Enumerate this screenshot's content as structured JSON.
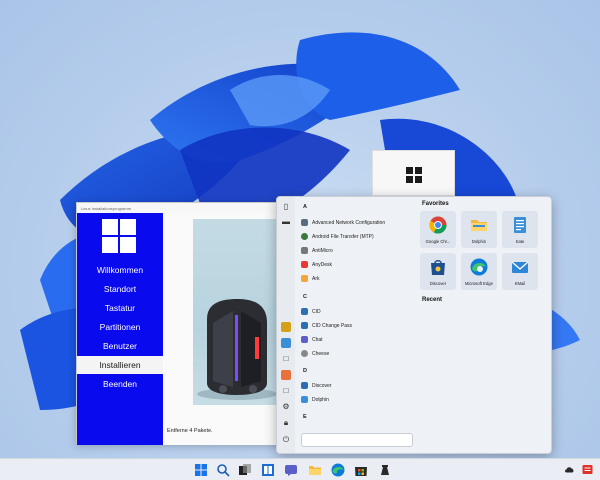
{
  "installer": {
    "title": "Linux Installationsprogramm",
    "sidebar": [
      {
        "label": "Willkommen",
        "active": false
      },
      {
        "label": "Standort",
        "active": false
      },
      {
        "label": "Tastatur",
        "active": false
      },
      {
        "label": "Partitionen",
        "active": false
      },
      {
        "label": "Benutzer",
        "active": false
      },
      {
        "label": "Installieren",
        "active": true
      },
      {
        "label": "Beenden",
        "active": false
      }
    ],
    "status": "Entferne 4 Pakete."
  },
  "start_menu": {
    "groups": [
      {
        "letter": "A",
        "apps": [
          {
            "label": "Advanced Network Configuration",
            "icon": "network-icon",
            "color": "#5a6b7d"
          },
          {
            "label": "Android File Transfer (MTP)",
            "icon": "android-icon",
            "color": "#3b7a3b"
          },
          {
            "label": "AntiMicro",
            "icon": "gamepad-icon",
            "color": "#777777"
          },
          {
            "label": "AnyDesk",
            "icon": "anydesk-icon",
            "color": "#e53935"
          },
          {
            "label": "Ark",
            "icon": "archive-icon",
            "color": "#f0a63a"
          }
        ]
      },
      {
        "letter": "C",
        "apps": [
          {
            "label": "CID",
            "icon": "cid-icon",
            "color": "#2c6fb3"
          },
          {
            "label": "CID Change Pass",
            "icon": "key-icon",
            "color": "#2c6fb3"
          },
          {
            "label": "Chat",
            "icon": "chat-icon",
            "color": "#5b5fc7"
          },
          {
            "label": "Cheese",
            "icon": "camera-icon",
            "color": "#888888"
          }
        ]
      },
      {
        "letter": "D",
        "apps": [
          {
            "label": "Discover",
            "icon": "discover-icon",
            "color": "#2d6cb5"
          },
          {
            "label": "Dolphin",
            "icon": "dolphin-icon",
            "color": "#3a8fd6"
          }
        ]
      },
      {
        "letter": "E",
        "apps": []
      }
    ],
    "favorites_title": "Favorites",
    "favorites": [
      {
        "label": "Google Chr...",
        "icon": "chrome-icon"
      },
      {
        "label": "Dolphin",
        "icon": "folder-icon"
      },
      {
        "label": "Kate",
        "icon": "kate-icon"
      },
      {
        "label": "Discover",
        "icon": "discover-icon"
      },
      {
        "label": "Microsoft Edge",
        "icon": "edge-icon"
      },
      {
        "label": "KMail",
        "icon": "mail-icon"
      }
    ],
    "recent_title": "Recent"
  },
  "taskbar": {
    "icons": [
      "start-icon",
      "search-icon",
      "task-view-icon",
      "widgets-icon",
      "chat-icon",
      "file-explorer-icon",
      "edge-icon",
      "store-icon",
      "terminal-icon"
    ],
    "tray": [
      "cloud-icon",
      "notification-icon"
    ]
  },
  "colors": {
    "installer_sidebar": "#0a0aef",
    "accent": "#0078d4"
  }
}
